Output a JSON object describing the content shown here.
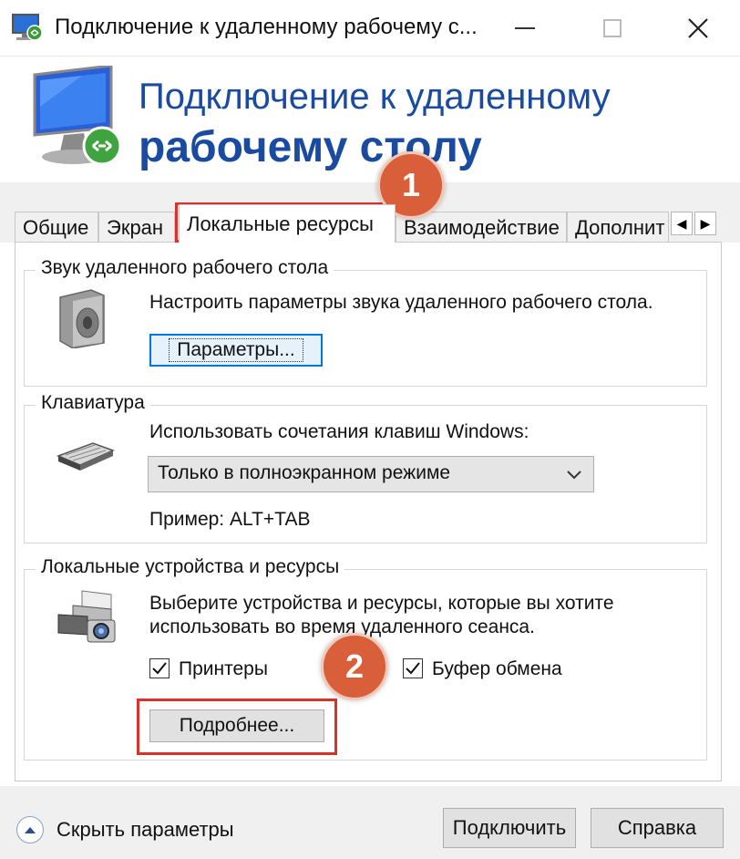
{
  "window": {
    "title": "Подключение к удаленному рабочему с...",
    "minimize_icon": "minimize-icon",
    "maximize_icon": "maximize-icon",
    "close_icon": "close-icon"
  },
  "banner": {
    "line1": "Подключение к удаленному",
    "line2": "рабочему столу"
  },
  "tabs": [
    {
      "label": "Общие"
    },
    {
      "label": "Экран"
    },
    {
      "label": "Локальные ресурсы"
    },
    {
      "label": "Взаимодействие"
    },
    {
      "label": "Дополнит"
    }
  ],
  "tab_scroll": {
    "left": "◀",
    "right": "▶"
  },
  "sound": {
    "title": "Звук удаленного рабочего стола",
    "description": "Настроить параметры звука удаленного рабочего стола.",
    "button": "Параметры..."
  },
  "keyboard": {
    "title": "Клавиатура",
    "description": "Использовать сочетания клавиш Windows:",
    "selected": "Только в полноэкранном режиме",
    "example": "Пример: ALT+TAB"
  },
  "local_devices": {
    "title": "Локальные устройства и ресурсы",
    "description_line1": "Выберите устройства и ресурсы, которые вы хотите",
    "description_line2": "использовать во время удаленного сеанса.",
    "printers_label": "Принтеры",
    "printers_checked": true,
    "clipboard_label": "Буфер обмена",
    "clipboard_checked": true,
    "more_button": "Подробнее..."
  },
  "annotations": {
    "marker1": "1",
    "marker2": "2",
    "color": "#d85f3a",
    "highlight_color": "#d9322b"
  },
  "footer": {
    "hide_options": "Скрыть параметры",
    "connect": "Подключить",
    "help": "Справка"
  },
  "colors": {
    "accent": "#1a4ba0",
    "focus": "#0078d7"
  }
}
